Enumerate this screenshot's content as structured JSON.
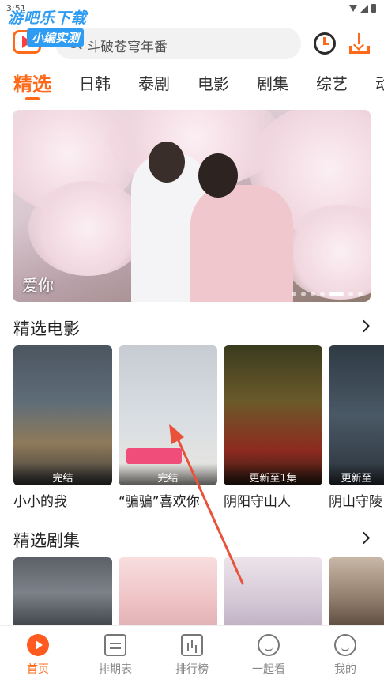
{
  "status_bar": {
    "time": "3:51"
  },
  "watermark": {
    "line1": "游吧乐下载",
    "line2": "小编实测"
  },
  "search": {
    "placeholder": "斗破苍穹年番"
  },
  "tabs": [
    {
      "label": "精选",
      "active": true
    },
    {
      "label": "日韩"
    },
    {
      "label": "泰剧"
    },
    {
      "label": "电影"
    },
    {
      "label": "剧集"
    },
    {
      "label": "综艺"
    },
    {
      "label": "动"
    }
  ],
  "banner": {
    "title": "爱你",
    "slide_count": 7,
    "active_slide": 5
  },
  "movies_section": {
    "title": "精选电影",
    "items": [
      {
        "title": "小小的我",
        "badge": "完结"
      },
      {
        "title": "“骗骗”喜欢你",
        "badge": "完结"
      },
      {
        "title": "阴阳守山人",
        "badge": "更新至1集"
      },
      {
        "title": "阴山守陵",
        "badge": "更新至"
      }
    ]
  },
  "series_section": {
    "title": "精选剧集"
  },
  "bottom_nav": [
    {
      "label": "首页",
      "active": true,
      "icon": "home-play-icon"
    },
    {
      "label": "排期表",
      "icon": "calendar-icon"
    },
    {
      "label": "排行榜",
      "icon": "ranking-icon"
    },
    {
      "label": "一起看",
      "icon": "chat-icon"
    },
    {
      "label": "我的",
      "icon": "profile-icon"
    }
  ],
  "colors": {
    "accent": "#ff6a1a",
    "annotation_arrow": "#e8523a"
  }
}
